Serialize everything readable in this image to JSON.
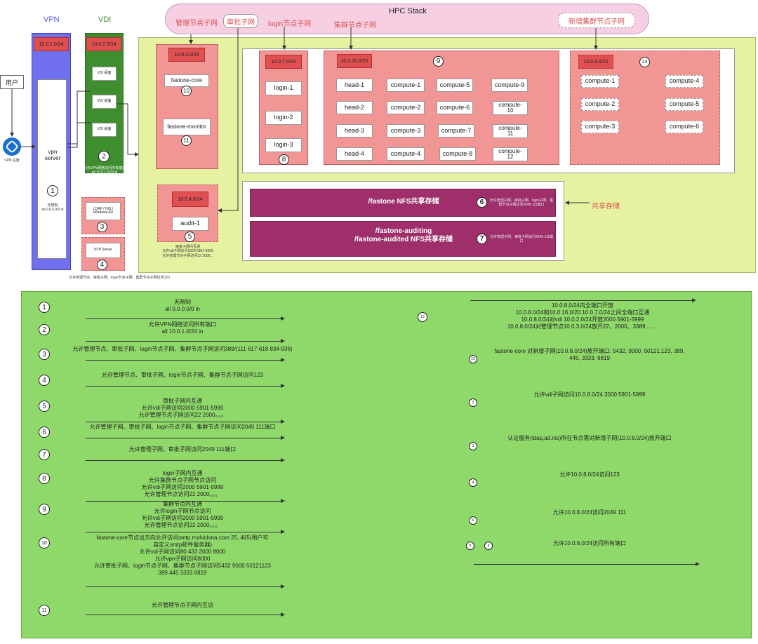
{
  "hpc_stack": {
    "title": "HPC Stack",
    "tags": [
      "管理节点子网",
      "审批子网",
      "login节点子网",
      "集群节点子网",
      "新增集群节点子网"
    ]
  },
  "vpn": {
    "title": "VPN",
    "subnet": "10.0.1.0/24",
    "server_label": "vpn\nserver",
    "badge": "1",
    "note": "无限制\nall 0.0.0.0/0 in",
    "service_label": "VPN 在建"
  },
  "user": {
    "label": "用户"
  },
  "vdi": {
    "title": "VDI",
    "subnet": "10.0.2.0/24",
    "desktops": [
      "VDI 桌面",
      "VDI 桌面",
      "VDI 桌面"
    ],
    "badge": "2",
    "note": "允许VPN网络访问所有端口\nall 10.0.1.0/24 in"
  },
  "services": {
    "ldap": "LDAP / NIS /\nWindows AD",
    "ldap_badge": "3",
    "ntp": "NTP Server",
    "ntp_badge": "4",
    "note": "允许管理节点、审批子网、login节点子网、集群节点子网访问123"
  },
  "mgmt": {
    "subnet": "10.0.3.0/24",
    "core": "fastone-core",
    "core_badge": "10",
    "monitor": "fastone-monitor",
    "monitor_badge": "11"
  },
  "audit": {
    "subnet": "10.0.4.0/24",
    "node": "audit-1",
    "badge": "5",
    "note": "审批子网内互通\n允许vdi子网访问2000 5901-5999\n允许管理节点子网访问22 2000..."
  },
  "login": {
    "subnet": "10.0.7.0/24",
    "nodes": [
      "login-1",
      "login-2",
      "login-3"
    ],
    "badge": "8"
  },
  "cluster": {
    "subnet": "10.0.16.0/20",
    "badge": "9",
    "heads": [
      "head-1",
      "head-2",
      "head-3",
      "head-4"
    ],
    "compute_a": [
      "compute-1",
      "compute-2",
      "compute-3",
      "compute-4"
    ],
    "compute_b": [
      "compute-5",
      "compute-6",
      "compute-7",
      "compute-8"
    ],
    "compute_c": [
      "compute-9",
      "compute-\n10",
      "compute-\n11",
      "compute-\n12"
    ]
  },
  "new_cluster": {
    "subnet": "10.0.8.0/20",
    "badge": "13",
    "left": [
      "compute-1",
      "compute-2",
      "compute-3"
    ],
    "right": [
      "compute-4",
      "compute-5",
      "compute-6"
    ]
  },
  "storage": {
    "label": "共享存储",
    "nfs": "/fastone NFS共享存储",
    "nfs_badge": "6",
    "nfs_note": "允许管理子网、审批子网、login子网、集群节点子网访问2049 111端口",
    "audit_store": "/fastone-auditing\n/fastone-audited NFS共享存储",
    "audit_badge": "7",
    "audit_note": "允许管理子网、审批子网访问2049 111端口"
  },
  "rules_left": [
    {
      "n": "1",
      "text": "无限制\nall 0.0.0.0/0 in"
    },
    {
      "n": "2",
      "text": "允许VPN网络访问所有端口\nall 10.0.1.0/24 in"
    },
    {
      "n": "3",
      "text": "允许管理节点、审批子网、login节点子网、集群节点子网访问389/(111 617-618 834-936)"
    },
    {
      "n": "4",
      "text": "允许管理节点、审批子网、login节点子网、集群节点子网访问123"
    },
    {
      "n": "5",
      "text": "审批子网内互通\n允许vdi子网访问2000 5901-5999\n允许管理节点子网访问22 2000。。。"
    },
    {
      "n": "6",
      "text": "允许管理子网、审批子网、login节点子网、集群节点子网访问2049 111端口"
    },
    {
      "n": "7",
      "text": "允许管理子网、审批子网访问2049 111端口"
    },
    {
      "n": "8",
      "text": "login子网内互通\n允许集群节点子网节点访问\n允许vdi子网访问2000 5901-5999\n允许管理节点访问22 2000。。。"
    },
    {
      "n": "9",
      "text": "集群节点内互通\n允许login子网节点访问\n允许vdi子网访问2000 5901-5999\n允许管理节点访问22 2000。。。"
    },
    {
      "n": "10",
      "text": "fastone-core节点出方向允许访问smtp.mxhichina.com 25, 465(用户可\n自定义smtp邮件服务器)\n允许vdi子网访问80 433 2000 8000\n允许vpn子网访问8000\n允许审批子网、login节点子网、集群节点子网访问5432 9000 50121123\n389 445 3333 6819"
    },
    {
      "n": "11",
      "text": "允许管理节点子网内互访"
    }
  ],
  "rules_right": [
    {
      "n": "13",
      "text": "10.0.8.0/24内全端口开放\n10.0.8.0/24和10.0.16.0/20 10.0.7.0/24之间全端口互通\n10.0.8.0/24对vdi 10.0.2.0/24开放2000 5901-5999\n10.0.8.0/24对管理节点10.0.3.0/24放开22、2000、3389........"
    },
    {
      "n": "10",
      "text": "fastone-core 对新增子网(10.0.8.0/24)放开端口: 5432, 9000, 50121,123, 389,\n445, 3333, 6819"
    },
    {
      "n": "2",
      "text": "允许vdi子网访问10.0.8.0/24 2000 5901-5999"
    },
    {
      "n": "3",
      "text": "认证服务(ldap,ad,nis)所在节点需对新增子网(10.0.8.0/24)放开端口"
    },
    {
      "n": "4",
      "text": "允许10.0.8.0/24访问123"
    },
    {
      "n": "6",
      "text": "允许10.0.8.0/24访问2049 111"
    },
    {
      "n": "8",
      "n2": "9",
      "text": "允许10.0.8.0/24访问所有端口"
    }
  ],
  "colors": {
    "vpn_panel": "#7070ee",
    "vdi_panel": "#3e8e2f",
    "hpc_panel": "#e6f2a2",
    "subnet_box": "#f19595",
    "subnet_tag": "#e05050",
    "storage": "#9e2f6a",
    "rules_panel": "#8fd96a",
    "stack_header": "#f6cfe3"
  }
}
